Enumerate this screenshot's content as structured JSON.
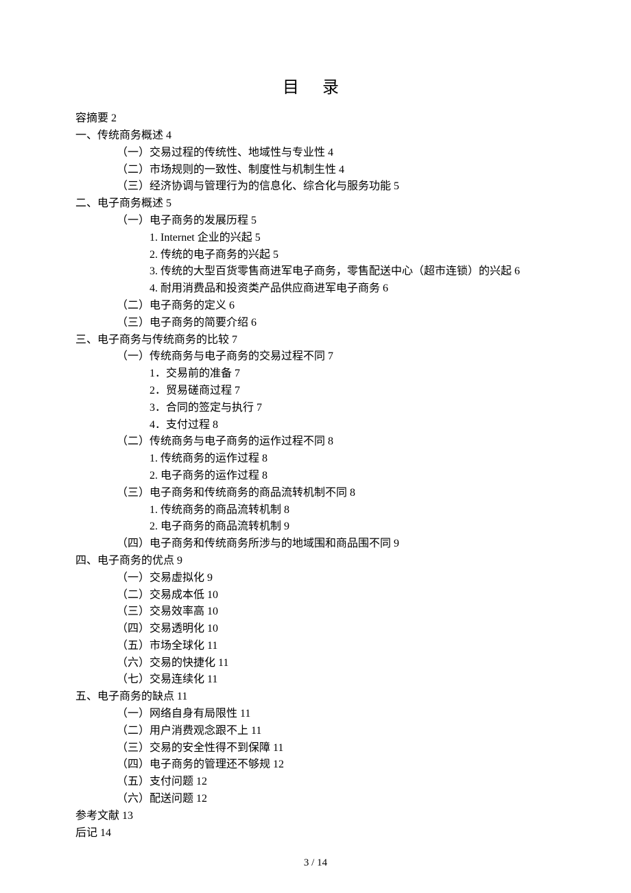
{
  "title": "目 录",
  "entries": [
    {
      "indent": 0,
      "text": "容摘要",
      "page": "2"
    },
    {
      "indent": 0,
      "text": "一、传统商务概述",
      "page": "4"
    },
    {
      "indent": 1,
      "text": "（一）交易过程的传统性、地域性与专业性",
      "page": "4"
    },
    {
      "indent": 1,
      "text": "（二）市场规则的一致性、制度性与机制生性",
      "page": "4"
    },
    {
      "indent": 1,
      "text": "（三）经济协调与管理行为的信息化、综合化与服务功能",
      "page": "5"
    },
    {
      "indent": 0,
      "text": "二、电子商务概述",
      "page": "5"
    },
    {
      "indent": 1,
      "text": "（一）电子商务的发展历程",
      "page": "5"
    },
    {
      "indent": 2,
      "text": "1. Internet 企业的兴起",
      "page": "5"
    },
    {
      "indent": 2,
      "text": "2. 传统的电子商务的兴起",
      "page": "5"
    },
    {
      "indent": 2,
      "text": "3. 传统的大型百货零售商进军电子商务，零售配送中心（超市连锁）的兴起",
      "page": "6"
    },
    {
      "indent": 2,
      "text": "4. 耐用消费品和投资类产品供应商进军电子商务",
      "page": "6"
    },
    {
      "indent": 1,
      "text": "（二）电子商务的定义",
      "page": "6"
    },
    {
      "indent": 1,
      "text": "（三）电子商务的简要介绍",
      "page": "6"
    },
    {
      "indent": 0,
      "text": "三、电子商务与传统商务的比较",
      "page": "7"
    },
    {
      "indent": 1,
      "text": "（一）传统商务与电子商务的交易过程不同",
      "page": "7"
    },
    {
      "indent": 2,
      "text": "1．交易前的准备",
      "page": "7"
    },
    {
      "indent": 2,
      "text": "2．贸易磋商过程",
      "page": "7"
    },
    {
      "indent": 2,
      "text": "3．合同的签定与执行",
      "page": "7"
    },
    {
      "indent": 2,
      "text": "4．支付过程",
      "page": "8"
    },
    {
      "indent": 1,
      "text": "（二）传统商务与电子商务的运作过程不同",
      "page": "8"
    },
    {
      "indent": 2,
      "text": "1. 传统商务的运作过程",
      "page": "8"
    },
    {
      "indent": 2,
      "text": "2. 电子商务的运作过程",
      "page": "8"
    },
    {
      "indent": 1,
      "text": "（三）电子商务和传统商务的商品流转机制不同",
      "page": "8"
    },
    {
      "indent": 2,
      "text": "1. 传统商务的商品流转机制",
      "page": "8"
    },
    {
      "indent": 2,
      "text": "2. 电子商务的商品流转机制",
      "page": "9"
    },
    {
      "indent": 1,
      "text": "（四）电子商务和传统商务所涉与的地域围和商品围不同",
      "page": "9"
    },
    {
      "indent": 0,
      "text": "四、电子商务的优点",
      "page": "9"
    },
    {
      "indent": 1,
      "text": "（一）交易虚拟化",
      "page": "9"
    },
    {
      "indent": 1,
      "text": "（二）交易成本低",
      "page": "10"
    },
    {
      "indent": 1,
      "text": "（三）交易效率高",
      "page": "10"
    },
    {
      "indent": 1,
      "text": "（四）交易透明化",
      "page": "10"
    },
    {
      "indent": 1,
      "text": "（五）市场全球化",
      "page": "11"
    },
    {
      "indent": 1,
      "text": "（六）交易的快捷化",
      "page": "11"
    },
    {
      "indent": 1,
      "text": "（七）交易连续化",
      "page": "11"
    },
    {
      "indent": 0,
      "text": "五、电子商务的缺点",
      "page": "11"
    },
    {
      "indent": 1,
      "text": "（一）网络自身有局限性",
      "page": "11"
    },
    {
      "indent": 1,
      "text": "（二）用户消费观念跟不上",
      "page": "11"
    },
    {
      "indent": 1,
      "text": "（三）交易的安全性得不到保障",
      "page": "11"
    },
    {
      "indent": 1,
      "text": "（四）电子商务的管理还不够规",
      "page": "12"
    },
    {
      "indent": 1,
      "text": "（五）支付问题",
      "page": "12"
    },
    {
      "indent": 1,
      "text": "（六）配送问题",
      "page": "12"
    },
    {
      "indent": 0,
      "text": "参考文献",
      "page": "13"
    },
    {
      "indent": 0,
      "text": "后记",
      "page": "14"
    }
  ],
  "footer": "3 / 14"
}
